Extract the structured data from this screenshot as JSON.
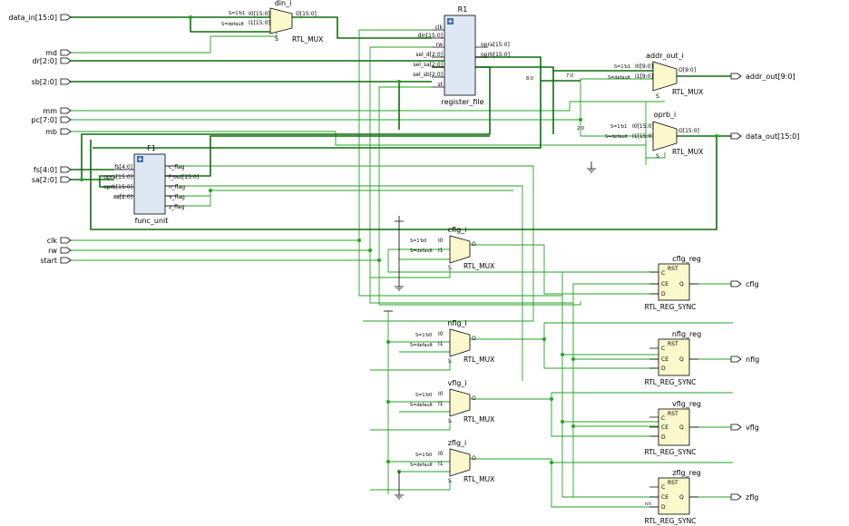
{
  "inputs": {
    "data_in": "data_in[15:0]",
    "md": "md",
    "dr": "dr[2:0]",
    "sb": "sb[2:0]",
    "mm": "mm",
    "pc": "pc[7:0]",
    "mb": "mb",
    "fs": "fs[4:0]",
    "sa": "sa[2:0]",
    "clk": "clk",
    "rw": "rw",
    "start": "start"
  },
  "outputs": {
    "addr_out": "addr_out[9:0]",
    "data_out": "data_out[15:0]",
    "cflg": "cflg",
    "nflg": "nflg",
    "vflg": "vflg",
    "zflg": "zflg"
  },
  "register_file": {
    "instance": "R1",
    "type": "register_file",
    "pins_left": [
      "clk",
      "din[15:0]",
      "rw",
      "sel_d[2:0]",
      "sel_sa[2:0]",
      "sel_sb[2:0]",
      "st"
    ],
    "pins_right": [
      "opra[15:0]",
      "oprb[15:0]"
    ]
  },
  "func_unit": {
    "instance": "F1",
    "type": "func_unit",
    "pins_left": [
      "fs[4:0]",
      "opra[15:0]",
      "oprb[15:0]",
      "sa[2:0]"
    ],
    "pins_right": [
      "c_flag",
      "f_out[15:0]",
      "n_flag",
      "v_flag",
      "z_flag"
    ]
  },
  "muxes": {
    "din": {
      "instance": "din_i",
      "type": "RTL_MUX",
      "sel0": "S=1'b1",
      "sel1": "S=default",
      "in0": "I0[15:0]",
      "in1": "I1[15:0]",
      "out": "O[15:0]",
      "s": "S"
    },
    "addr": {
      "instance": "addr_out_i",
      "type": "RTL_MUX",
      "sel0": "S=1'b1",
      "sel1": "S=default",
      "in0": "I0[9:0]",
      "in1": "I1[9:0]",
      "out": "O[9:0]",
      "s": "S"
    },
    "oprb": {
      "instance": "oprb_i",
      "type": "RTL_MUX",
      "sel0": "S=1'b1",
      "sel1": "S=default",
      "in0": "I0[15:0]",
      "in1": "I1[15:0]",
      "out": "O[15:0]",
      "s": "S"
    },
    "cflg": {
      "instance": "cflg_i",
      "type": "RTL_MUX",
      "sel0": "S=1'b0",
      "sel1": "S=default",
      "in0": "I0",
      "in1": "I1",
      "out": "O",
      "s": "S"
    },
    "nflg": {
      "instance": "nflg_i",
      "type": "RTL_MUX",
      "sel0": "S=1'b0",
      "sel1": "S=default",
      "in0": "I0",
      "in1": "I1",
      "out": "O",
      "s": "S"
    },
    "vflg": {
      "instance": "vflg_i",
      "type": "RTL_MUX",
      "sel0": "S=1'b0",
      "sel1": "S=default",
      "in0": "I0",
      "in1": "I1",
      "out": "O",
      "s": "S"
    },
    "zflg": {
      "instance": "zflg_i",
      "type": "RTL_MUX",
      "sel0": "S=1'b0",
      "sel1": "S=default",
      "in0": "I0",
      "in1": "I1",
      "out": "O",
      "s": "S"
    }
  },
  "registers": {
    "cflg": {
      "instance": "cflg_reg",
      "type": "RTL_REG_SYNC",
      "pins": [
        "RST",
        "C",
        "CE",
        "D",
        "Q"
      ]
    },
    "nflg": {
      "instance": "nflg_reg",
      "type": "RTL_REG_SYNC",
      "pins": [
        "RST",
        "C",
        "CE",
        "D",
        "Q"
      ]
    },
    "vflg": {
      "instance": "vflg_reg",
      "type": "RTL_REG_SYNC",
      "pins": [
        "RST",
        "C",
        "CE",
        "D",
        "Q"
      ]
    },
    "zflg": {
      "instance": "zflg_reg",
      "type": "RTL_REG_SYNC",
      "pins": [
        "RST",
        "C",
        "CE",
        "D",
        "Q"
      ]
    }
  },
  "bus_labels": {
    "pc_lo": "7:0",
    "pc_hi": "2:0",
    "reg_bus": "8:0",
    "zflg_d": "n/c"
  },
  "colors": {
    "wire": "#23a323",
    "bus": "#0f6d0f",
    "block": "#dde8f4",
    "primitive": "#fbf8cc"
  }
}
